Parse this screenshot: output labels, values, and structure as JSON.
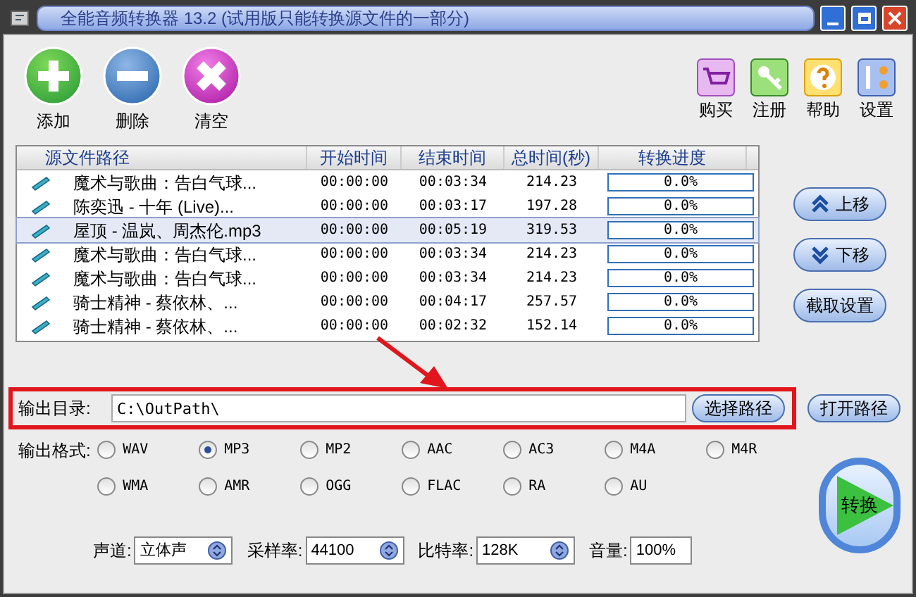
{
  "window": {
    "title": "全能音频转换器 13.2 (试用版只能转换源文件的一部分)"
  },
  "toolbar_left": [
    {
      "label": "添加",
      "kind": "add"
    },
    {
      "label": "删除",
      "kind": "remove"
    },
    {
      "label": "清空",
      "kind": "clear"
    }
  ],
  "toolbar_right": [
    {
      "label": "购买",
      "kind": "cart"
    },
    {
      "label": "注册",
      "kind": "key"
    },
    {
      "label": "帮助",
      "kind": "help"
    },
    {
      "label": "设置",
      "kind": "settings"
    }
  ],
  "table": {
    "columns": [
      "源文件路径",
      "开始时间",
      "结束时间",
      "总时间(秒)",
      "转换进度"
    ],
    "rows": [
      {
        "name": "魔术与歌曲：告白气球...",
        "start": "00:00:00",
        "end": "00:03:34",
        "total": "214.23",
        "progress": "0.0%",
        "selected": false
      },
      {
        "name": "陈奕迅 - 十年 (Live)...",
        "start": "00:00:00",
        "end": "00:03:17",
        "total": "197.28",
        "progress": "0.0%",
        "selected": false
      },
      {
        "name": "屋顶 - 温岚、周杰伦.mp3",
        "start": "00:00:00",
        "end": "00:05:19",
        "total": "319.53",
        "progress": "0.0%",
        "selected": true
      },
      {
        "name": "魔术与歌曲：告白气球...",
        "start": "00:00:00",
        "end": "00:03:34",
        "total": "214.23",
        "progress": "0.0%",
        "selected": false
      },
      {
        "name": "魔术与歌曲：告白气球...",
        "start": "00:00:00",
        "end": "00:03:34",
        "total": "214.23",
        "progress": "0.0%",
        "selected": false
      },
      {
        "name": "骑士精神 - 蔡依林、...",
        "start": "00:00:00",
        "end": "00:04:17",
        "total": "257.57",
        "progress": "0.0%",
        "selected": false
      },
      {
        "name": "骑士精神 - 蔡依林、...",
        "start": "00:00:00",
        "end": "00:02:32",
        "total": "152.14",
        "progress": "0.0%",
        "selected": false
      }
    ]
  },
  "side_buttons": [
    {
      "label": "上移",
      "kind": "up"
    },
    {
      "label": "下移",
      "kind": "down"
    },
    {
      "label": "截取设置",
      "kind": "plain"
    }
  ],
  "output": {
    "label": "输出目录:",
    "value": "C:\\OutPath\\",
    "browse_button": "选择路径",
    "open_button": "打开路径"
  },
  "formats": {
    "label": "输出格式:",
    "options": [
      {
        "label": "WAV",
        "selected": false
      },
      {
        "label": "MP3",
        "selected": true
      },
      {
        "label": "MP2",
        "selected": false
      },
      {
        "label": "AAC",
        "selected": false
      },
      {
        "label": "AC3",
        "selected": false
      },
      {
        "label": "M4A",
        "selected": false
      },
      {
        "label": "M4R",
        "selected": false
      },
      {
        "label": "WMA",
        "selected": false
      },
      {
        "label": "AMR",
        "selected": false
      },
      {
        "label": "OGG",
        "selected": false
      },
      {
        "label": "FLAC",
        "selected": false
      },
      {
        "label": "RA",
        "selected": false
      },
      {
        "label": "AU",
        "selected": false
      }
    ]
  },
  "convert_button": "转换",
  "settings": [
    {
      "label": "声道:",
      "value": "立体声",
      "kind": "select"
    },
    {
      "label": "采样率:",
      "value": "44100",
      "kind": "select"
    },
    {
      "label": "比特率:",
      "value": "128K",
      "kind": "select"
    },
    {
      "label": "音量:",
      "value": "100%",
      "kind": "field"
    }
  ]
}
